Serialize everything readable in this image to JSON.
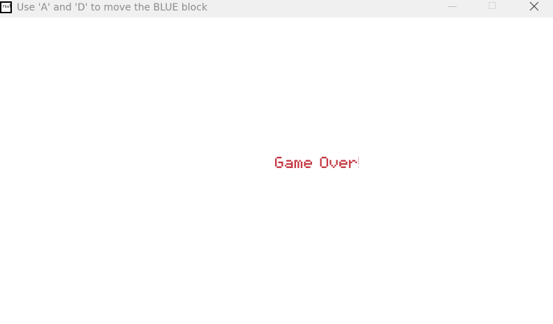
{
  "window": {
    "title": "Use 'A' and 'D' to move the BLUE block",
    "icon_text": "rsult",
    "controls": {
      "minimize_icon": "minimize-icon",
      "maximize_icon": "maximize-icon",
      "close_icon": "close-icon"
    }
  },
  "game": {
    "message": "Game Over!",
    "message_color": "#c0303a",
    "background_color": "#ffffff"
  }
}
